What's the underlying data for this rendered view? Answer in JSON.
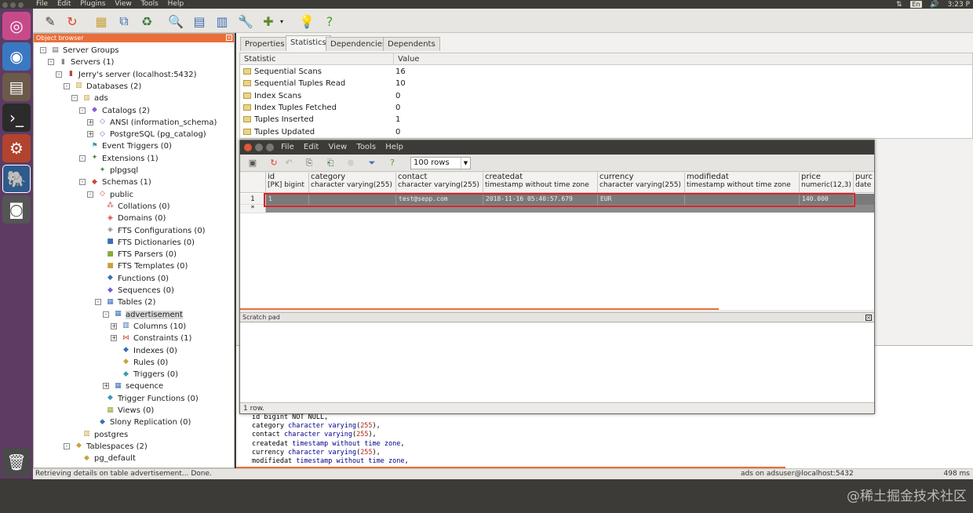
{
  "topbar": {
    "menus": [
      "File",
      "Edit",
      "Plugins",
      "View",
      "Tools",
      "Help"
    ],
    "lang": "En",
    "clock": "3:23 P"
  },
  "object_browser": {
    "title": "Object browser",
    "tree": [
      {
        "label": "Server Groups",
        "icon": "server-group-icon",
        "depth": 0,
        "exp": "-"
      },
      {
        "label": "Servers (1)",
        "icon": "servers-icon",
        "depth": 1,
        "exp": "-"
      },
      {
        "label": "Jerry's server (localhost:5432)",
        "icon": "server-icon",
        "depth": 2,
        "exp": "-"
      },
      {
        "label": "Databases (2)",
        "icon": "databases-icon",
        "depth": 3,
        "exp": "-"
      },
      {
        "label": "ads",
        "icon": "database-icon",
        "depth": 4,
        "exp": "-"
      },
      {
        "label": "Catalogs (2)",
        "icon": "catalogs-icon",
        "depth": 5,
        "exp": "-"
      },
      {
        "label": "ANSI (information_schema)",
        "icon": "catalog-icon",
        "depth": 6,
        "exp": "+"
      },
      {
        "label": "PostgreSQL (pg_catalog)",
        "icon": "catalog-icon",
        "depth": 6,
        "exp": "+"
      },
      {
        "label": "Event Triggers (0)",
        "icon": "event-trigger-icon",
        "depth": 5,
        "exp": ""
      },
      {
        "label": "Extensions (1)",
        "icon": "extensions-icon",
        "depth": 5,
        "exp": "-"
      },
      {
        "label": "plpgsql",
        "icon": "extension-icon",
        "depth": 6,
        "exp": ""
      },
      {
        "label": "Schemas (1)",
        "icon": "schemas-icon",
        "depth": 5,
        "exp": "-"
      },
      {
        "label": "public",
        "icon": "schema-icon",
        "depth": 6,
        "exp": "-"
      },
      {
        "label": "Collations (0)",
        "icon": "collations-icon",
        "depth": 7,
        "exp": ""
      },
      {
        "label": "Domains (0)",
        "icon": "domains-icon",
        "depth": 7,
        "exp": ""
      },
      {
        "label": "FTS Configurations (0)",
        "icon": "fts-config-icon",
        "depth": 7,
        "exp": ""
      },
      {
        "label": "FTS Dictionaries (0)",
        "icon": "fts-dict-icon",
        "depth": 7,
        "exp": ""
      },
      {
        "label": "FTS Parsers (0)",
        "icon": "fts-parser-icon",
        "depth": 7,
        "exp": ""
      },
      {
        "label": "FTS Templates (0)",
        "icon": "fts-template-icon",
        "depth": 7,
        "exp": ""
      },
      {
        "label": "Functions (0)",
        "icon": "functions-icon",
        "depth": 7,
        "exp": ""
      },
      {
        "label": "Sequences (0)",
        "icon": "sequences-icon",
        "depth": 7,
        "exp": ""
      },
      {
        "label": "Tables (2)",
        "icon": "tables-icon",
        "depth": 7,
        "exp": "-"
      },
      {
        "label": "advertisement",
        "icon": "table-icon",
        "depth": 8,
        "exp": "-",
        "selected": true
      },
      {
        "label": "Columns (10)",
        "icon": "columns-icon",
        "depth": 9,
        "exp": "+"
      },
      {
        "label": "Constraints (1)",
        "icon": "constraints-icon",
        "depth": 9,
        "exp": "+"
      },
      {
        "label": "Indexes (0)",
        "icon": "indexes-icon",
        "depth": 9,
        "exp": ""
      },
      {
        "label": "Rules (0)",
        "icon": "rules-icon",
        "depth": 9,
        "exp": ""
      },
      {
        "label": "Triggers (0)",
        "icon": "triggers-icon",
        "depth": 9,
        "exp": ""
      },
      {
        "label": "sequence",
        "icon": "table-icon",
        "depth": 8,
        "exp": "+"
      },
      {
        "label": "Trigger Functions (0)",
        "icon": "trigger-functions-icon",
        "depth": 7,
        "exp": ""
      },
      {
        "label": "Views (0)",
        "icon": "views-icon",
        "depth": 7,
        "exp": ""
      },
      {
        "label": "Slony Replication (0)",
        "icon": "slony-icon",
        "depth": 6,
        "exp": ""
      },
      {
        "label": "postgres",
        "icon": "database-icon",
        "depth": 4,
        "exp": ""
      },
      {
        "label": "Tablespaces (2)",
        "icon": "tablespaces-icon",
        "depth": 3,
        "exp": "-"
      },
      {
        "label": "pg_default",
        "icon": "tablespace-icon",
        "depth": 4,
        "exp": ""
      }
    ]
  },
  "tabs": [
    "Properties",
    "Statistics",
    "Dependencies",
    "Dependents"
  ],
  "active_tab": "Statistics",
  "stats": {
    "headers": [
      "Statistic",
      "Value"
    ],
    "rows": [
      {
        "k": "Sequential Scans",
        "v": "16"
      },
      {
        "k": "Sequential Tuples Read",
        "v": "10"
      },
      {
        "k": "Index Scans",
        "v": "0"
      },
      {
        "k": "Index Tuples Fetched",
        "v": "0"
      },
      {
        "k": "Tuples Inserted",
        "v": "1"
      },
      {
        "k": "Tuples Updated",
        "v": "0"
      }
    ]
  },
  "query_window": {
    "menus": [
      "File",
      "Edit",
      "View",
      "Tools",
      "Help"
    ],
    "row_limit": "100 rows",
    "columns": [
      {
        "name": "id",
        "type": "[PK] bigint"
      },
      {
        "name": "category",
        "type": "character varying(255)"
      },
      {
        "name": "contact",
        "type": "character varying(255)"
      },
      {
        "name": "createdat",
        "type": "timestamp without time zone"
      },
      {
        "name": "currency",
        "type": "character varying(255)"
      },
      {
        "name": "modifiedat",
        "type": "timestamp without time zone"
      },
      {
        "name": "price",
        "type": "numeric(12,3)"
      },
      {
        "name": "purc",
        "type": "date"
      }
    ],
    "row": {
      "num": "1",
      "cells": [
        "1",
        "",
        "test@sepp.com",
        "2018-11-16 05:40:57.679",
        "EUR",
        "",
        "140.000",
        ""
      ]
    },
    "new_row_marker": "*",
    "scratch_title": "Scratch pad",
    "status": "1 row."
  },
  "sql_lines": [
    [
      [
        "id ",
        ""
      ],
      [
        "bigint NOT NULL",
        ""
      ],
      [
        ",",
        ""
      ]
    ],
    [
      [
        "category ",
        ""
      ],
      [
        "character varying",
        "kw"
      ],
      [
        "(",
        ""
      ],
      [
        "255",
        "num"
      ],
      [
        "),",
        ""
      ]
    ],
    [
      [
        "contact ",
        ""
      ],
      [
        "character varying",
        "kw"
      ],
      [
        "(",
        ""
      ],
      [
        "255",
        "num"
      ],
      [
        "),",
        ""
      ]
    ],
    [
      [
        "createdat ",
        ""
      ],
      [
        "timestamp without time zone",
        "kw"
      ],
      [
        ",",
        ""
      ]
    ],
    [
      [
        "currency ",
        ""
      ],
      [
        "character varying",
        "kw"
      ],
      [
        "(",
        ""
      ],
      [
        "255",
        "num"
      ],
      [
        "),",
        ""
      ]
    ],
    [
      [
        "modifiedat ",
        ""
      ],
      [
        "timestamp without time zone",
        "kw"
      ],
      [
        ",",
        ""
      ]
    ]
  ],
  "statusbar": {
    "left": "Retrieving details on table advertisement... Done.",
    "mid": "ads on adsuser@localhost:5432",
    "right": "498 ms"
  },
  "watermark": "@稀土掘金技术社区"
}
